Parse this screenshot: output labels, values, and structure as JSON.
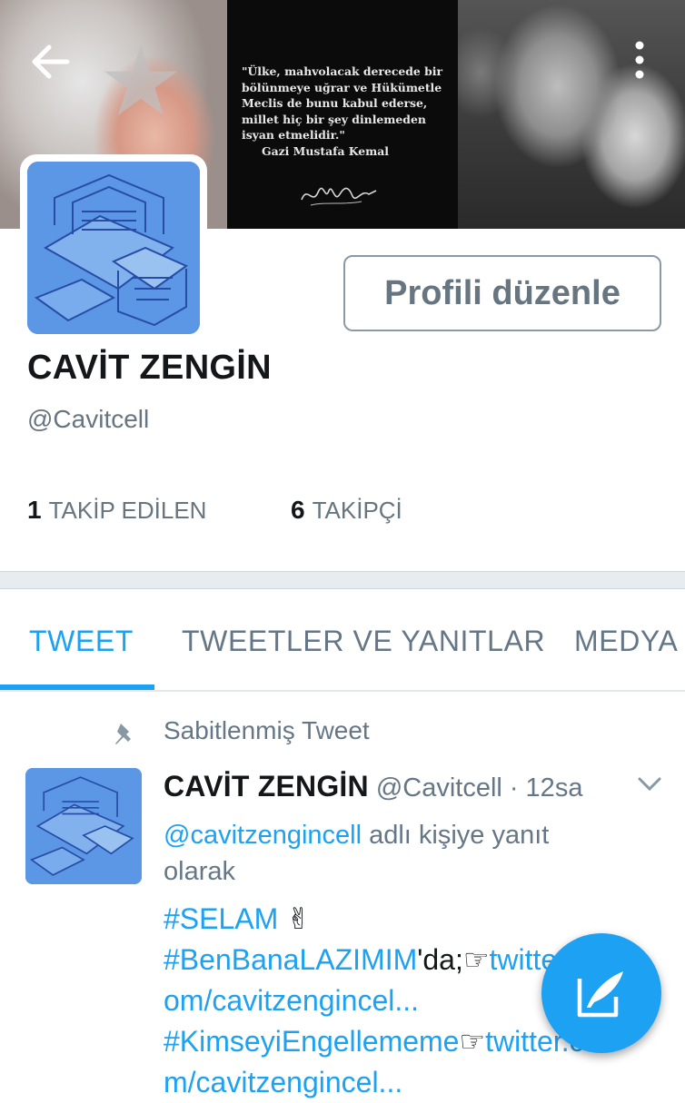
{
  "header": {
    "back_icon": "arrow-left-icon",
    "more_icon": "more-vertical-icon",
    "banner_quote": [
      "\"Ülke, mahvolacak derecede bir",
      "bölünmeye uğrar ve Hükümetle",
      "Meclis de bunu kabul ederse,",
      "millet hiç bir şey dinlemeden",
      "isyan etmelidir.\""
    ],
    "banner_attribution": "Gazi Mustafa Kemal"
  },
  "profile": {
    "edit_label": "Profili düzenle",
    "name": "CAVİT ZENGİN",
    "handle": "@Cavitcell",
    "following_count": "1",
    "following_label": "TAKİP EDİLEN",
    "followers_count": "6",
    "followers_label": "TAKİPÇİ"
  },
  "tabs": [
    {
      "label": "TWEET",
      "active": true
    },
    {
      "label": "TWEETLER VE YANITLAR",
      "active": false
    },
    {
      "label": "MEDYA",
      "active": false
    }
  ],
  "pinned": {
    "label": "Sabitlenmiş Tweet",
    "icon": "pin-icon"
  },
  "tweet": {
    "name": "CAVİT ZENGİN",
    "handle": "@Cavitcell",
    "time": "· 12sa",
    "reply_to_handle": "@cavitzengincell",
    "reply_text": "adlı kişiye yanıt olarak",
    "body_lines": [
      {
        "link": "#SELAM",
        "text": " ✌"
      },
      {
        "link": "#BenBanaLAZIMIM",
        "text": "'da;☞",
        "link2": "twitter.c"
      },
      {
        "link": "om/cavitzengincel...",
        "text": ""
      },
      {
        "link": "#KimseyiEngellememe",
        "text": "☞",
        "link2": "twitter.co"
      },
      {
        "link": "m/cavitzengincel...",
        "text": ""
      }
    ]
  },
  "fab": {
    "icon": "compose-tweet-icon"
  },
  "colors": {
    "accent": "#1da1f2",
    "text": "#14171a",
    "muted": "#657786"
  }
}
